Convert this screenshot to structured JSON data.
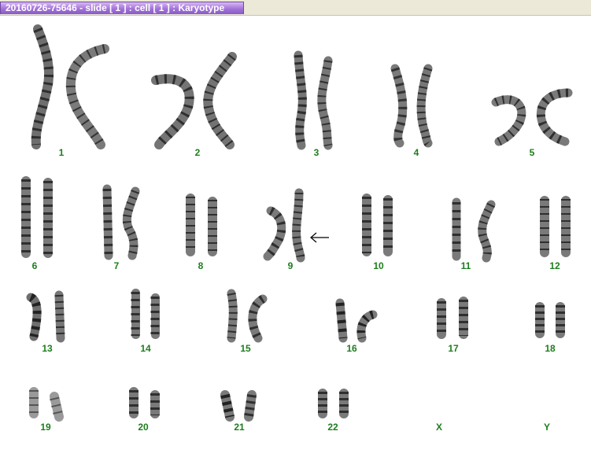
{
  "window": {
    "title": "20160726-75646 - slide [ 1 ] : cell [ 1 ] : Karyotype"
  },
  "karyotype": {
    "labels": {
      "c1": "1",
      "c2": "2",
      "c3": "3",
      "c4": "4",
      "c5": "5",
      "c6": "6",
      "c7": "7",
      "c8": "8",
      "c9": "9",
      "c10": "10",
      "c11": "11",
      "c12": "12",
      "c13": "13",
      "c14": "14",
      "c15": "15",
      "c16": "16",
      "c17": "17",
      "c18": "18",
      "c19": "19",
      "c20": "20",
      "c21": "21",
      "c22": "22",
      "cX": "X",
      "cY": "Y"
    },
    "marker_icon": "left-arrow-icon",
    "colors": {
      "label": "#1d7d1d",
      "title_tab": "#a173d8"
    }
  }
}
